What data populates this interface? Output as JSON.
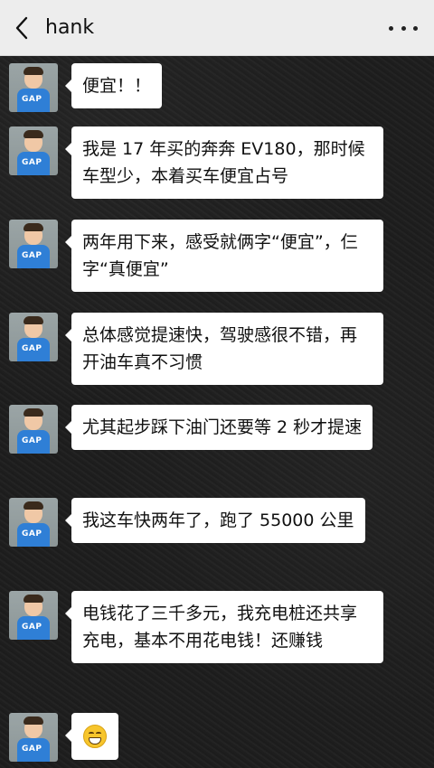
{
  "header": {
    "title": "hank"
  },
  "messages": [
    {
      "text": "便宜！！"
    },
    {
      "text": "我是 17 年买的奔奔 EV180，那时候车型少，本着买车便宜占号"
    },
    {
      "text": "两年用下来，感受就俩字“便宜”，仨字“真便宜”"
    },
    {
      "text": "总体感觉提速快，驾驶感很不错，再开油车真不习惯"
    },
    {
      "text": "尤其起步踩下油门还要等 2 秒才提速"
    },
    {
      "text": "我这车快两年了，跑了 55000 公里"
    },
    {
      "text": "电钱花了三千多元，我充电桩还共享充电，基本不用花电钱！还赚钱"
    },
    {
      "emoji": "grinning-face-icon"
    }
  ],
  "avatar": {
    "logo": "GAP"
  }
}
